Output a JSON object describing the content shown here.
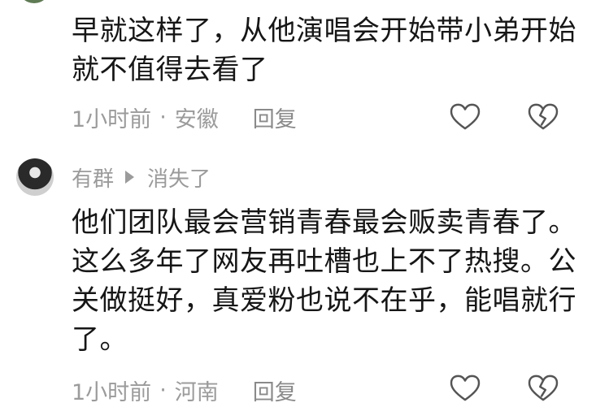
{
  "comments": [
    {
      "text": "早就这样了，从他演唱会开始带小弟开始就不值得去看了",
      "time": "1小时前",
      "separator": "·",
      "location": "安徽",
      "reply_label": "回复"
    },
    {
      "user": "有群",
      "reply_to": "消失了",
      "text": "他们团队最会营销青春最会贩卖青春了。这么多年了网友再吐槽也上不了热搜。公关做挺好，真爱粉也说不在乎，能唱就行了。",
      "time": "1小时前",
      "separator": "·",
      "location": "河南",
      "reply_label": "回复"
    }
  ],
  "icons": {
    "like": "heart-outline-icon",
    "dislike": "broken-heart-outline-icon",
    "reply_arrow": "play-triangle-icon"
  },
  "colors": {
    "text": "#161616",
    "meta": "#9b9b9b",
    "icon_stroke": "#555555"
  }
}
